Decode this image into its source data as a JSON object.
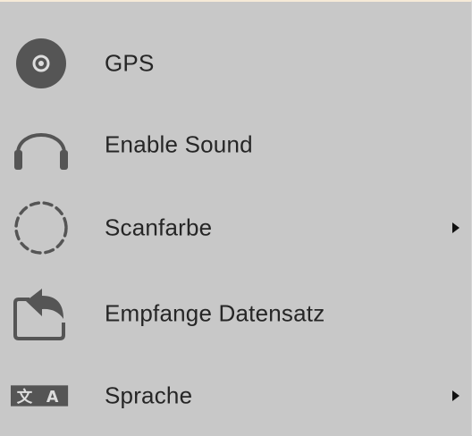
{
  "menu": {
    "items": [
      {
        "id": "gps",
        "label": "GPS",
        "icon": "gps-icon",
        "has_submenu": false
      },
      {
        "id": "sound",
        "label": "Enable Sound",
        "icon": "headphones-icon",
        "has_submenu": false
      },
      {
        "id": "scan-color",
        "label": "Scanfarbe",
        "icon": "dashed-circle-icon",
        "has_submenu": true
      },
      {
        "id": "receive-record",
        "label": "Empfange Datensatz",
        "icon": "receive-record-icon",
        "has_submenu": false
      },
      {
        "id": "language",
        "label": "Sprache",
        "icon": "language-icon",
        "has_submenu": true
      }
    ]
  },
  "colors": {
    "background": "#c8c8c8",
    "icon_dark": "#555555",
    "text": "#262626",
    "top_border": "#f6ead8"
  }
}
